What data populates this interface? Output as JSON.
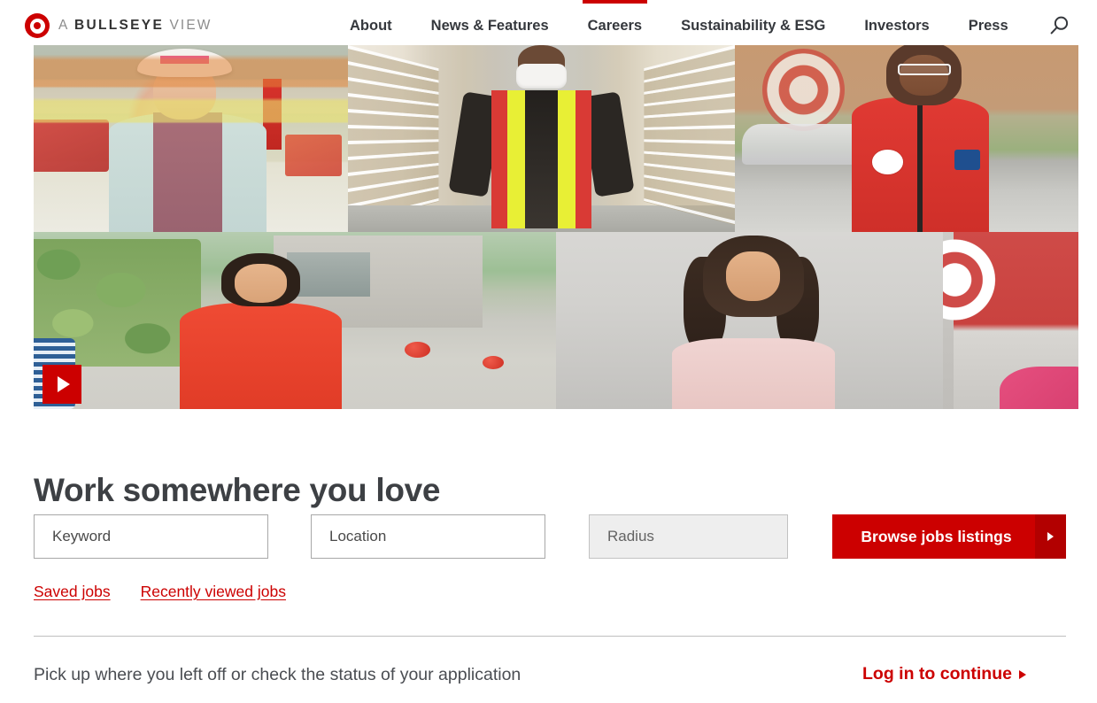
{
  "header": {
    "logo_icon": "target-bullseye-icon",
    "brand_prefix": "A ",
    "brand_bold": "BULLSEYE",
    "brand_suffix": " VIEW",
    "search_icon": "search-icon",
    "nav": [
      {
        "label": "About",
        "active": false
      },
      {
        "label": "News & Features",
        "active": false
      },
      {
        "label": "Careers",
        "active": true
      },
      {
        "label": "Sustainability & ESG",
        "active": false
      },
      {
        "label": "Investors",
        "active": false
      },
      {
        "label": "Press",
        "active": false
      }
    ]
  },
  "hero": {
    "play_icon": "play-icon",
    "tiles": [
      {
        "alt": "Team member in hard hat smiling inside store"
      },
      {
        "alt": "Distribution center team member in safety vest and face mask"
      },
      {
        "alt": "Team member in red vest with glasses outside store"
      },
      {
        "alt": "Team member in red polo shirt outside store entrance"
      },
      {
        "alt": "Team member in pink top smiling"
      },
      {
        "alt": "Target bullseye logo on store wall"
      }
    ]
  },
  "search": {
    "headline": "Work somewhere you love",
    "keyword_placeholder": "Keyword",
    "keyword_value": "",
    "location_placeholder": "Location",
    "location_value": "",
    "radius_placeholder": "Radius",
    "radius_value": "",
    "browse_button": "Browse jobs listings",
    "browse_arrow_icon": "chevron-right-icon",
    "links": [
      {
        "label": "Saved jobs"
      },
      {
        "label": "Recently viewed jobs"
      }
    ]
  },
  "resume": {
    "text": "Pick up where you left off or check the status of your application",
    "login_label": "Log in to continue",
    "login_arrow_icon": "chevron-right-icon"
  },
  "colors": {
    "brand_red": "#cc0000",
    "brand_red_dark": "#b20000",
    "nav_text": "#35383d",
    "heading": "#3d4044",
    "field_border": "#a8a8a8",
    "disabled_field_bg": "#eeeeee",
    "divider": "#bfbfbf"
  }
}
